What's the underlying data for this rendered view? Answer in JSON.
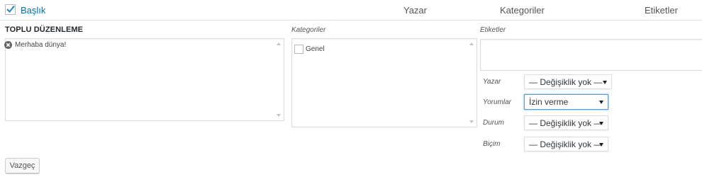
{
  "header": {
    "title_label": "Başlık",
    "author_label": "Yazar",
    "categories_label": "Kategoriler",
    "tags_label": "Etiketler"
  },
  "bulk_edit": {
    "heading": "TOPLU DÜZENLEME",
    "posts": [
      "Merhaba dünya!"
    ],
    "categories_label": "Kategoriler",
    "categories": [
      "Genel"
    ],
    "tags_label": "Etiketler",
    "tags_value": ""
  },
  "fields": {
    "author": {
      "label": "Yazar",
      "value": "— Değişiklik yok —"
    },
    "comments": {
      "label": "Yorumlar",
      "value": "İzin verme"
    },
    "status": {
      "label": "Durum",
      "value": "— Değişiklik yok —"
    },
    "format": {
      "label": "Biçim",
      "value": "— Değişiklik yok —"
    }
  },
  "buttons": {
    "cancel": "Vazgeç"
  },
  "colors": {
    "link": "#0073aa",
    "focus": "#5b9dd9"
  }
}
